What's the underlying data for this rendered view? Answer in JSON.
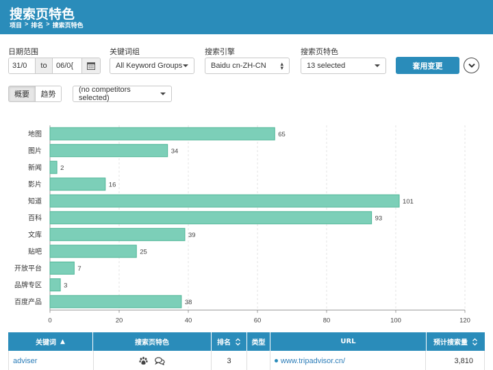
{
  "header": {
    "title": "搜索页特色",
    "breadcrumb": [
      "项目",
      "排名",
      "搜索页特色"
    ],
    "separator": ">"
  },
  "filters": {
    "date": {
      "label": "日期范围",
      "start": "31/0",
      "to": "to",
      "end": "06/0{"
    },
    "keyword_group": {
      "label": "关键词组",
      "value": "All Keyword Groups"
    },
    "engine": {
      "label": "搜索引擎",
      "value": "Baidu cn-ZH-CN"
    },
    "features": {
      "label": "搜索页特色",
      "value": "13 selected"
    },
    "apply_label": "套用变更"
  },
  "view": {
    "tabs": [
      "概要",
      "趋势"
    ],
    "active": 0,
    "competitors": "(no competitors selected)"
  },
  "colors": {
    "brand": "#2a8cba",
    "bar_fill": "#7ccfb8",
    "bar_stroke": "#4eb596",
    "link": "#2a7cb8"
  },
  "chart_data": {
    "type": "bar",
    "orientation": "horizontal",
    "categories": [
      "地图",
      "图片",
      "新闻",
      "影片",
      "知道",
      "百科",
      "文库",
      "贴吧",
      "开放平台",
      "品牌专区",
      "百度产品"
    ],
    "values": [
      65,
      34,
      2,
      16,
      101,
      93,
      39,
      25,
      7,
      3,
      38
    ],
    "xlim": [
      0,
      120
    ],
    "xticks": [
      0,
      20,
      40,
      60,
      80,
      100,
      120
    ],
    "grid": true
  },
  "table": {
    "columns": [
      "关键词",
      "搜索页特色",
      "排名",
      "类型",
      "URL",
      "预计搜索量"
    ],
    "rows": [
      {
        "keyword": "adviser",
        "features": [
          "paw-icon",
          "chat-bubbles-icon"
        ],
        "rank": "3",
        "type": "",
        "url": "www.tripadvisor.cn/",
        "volume": "3,810"
      }
    ]
  }
}
